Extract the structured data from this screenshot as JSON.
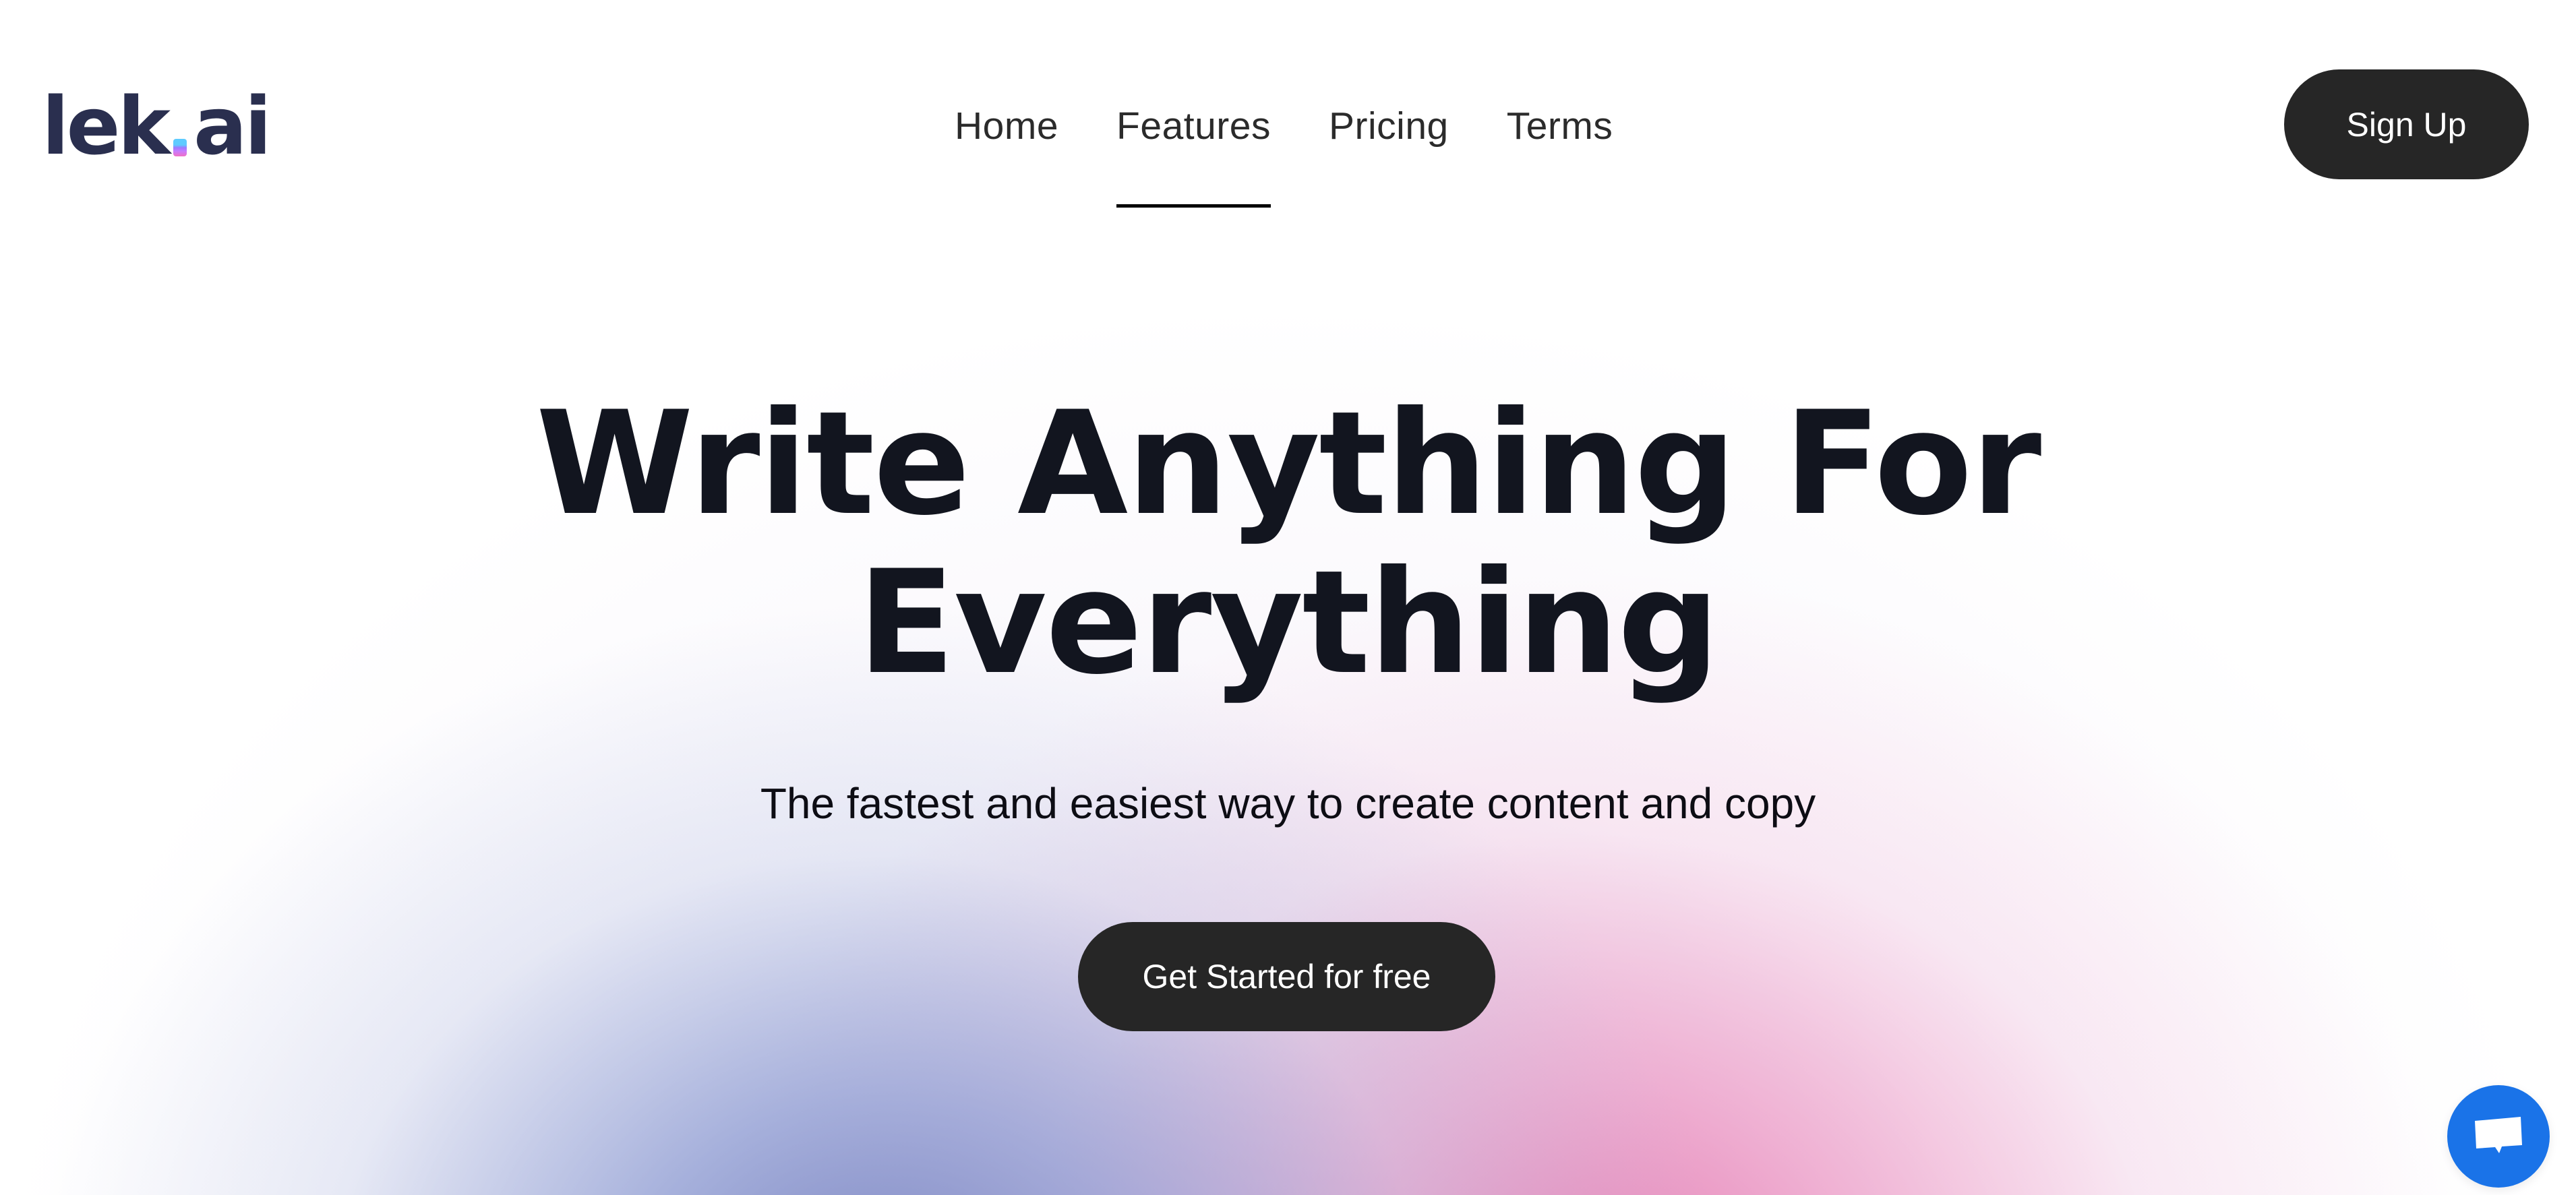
{
  "brand": {
    "logo_text_before": "lek",
    "logo_text_after": "ai",
    "logo_color": "#2a2f4f",
    "logo_dot_colors": [
      "#5ecbff",
      "#9b7bff",
      "#f06fc6"
    ]
  },
  "nav": {
    "items": [
      {
        "label": "Home",
        "active": false
      },
      {
        "label": "Features",
        "active": true
      },
      {
        "label": "Pricing",
        "active": false
      },
      {
        "label": "Terms",
        "active": false
      }
    ]
  },
  "header": {
    "signup_label": "Sign Up"
  },
  "hero": {
    "title_line1": "Write Anything For",
    "title_line2": "Everything",
    "subtitle": "The fastest and easiest way to create content and copy",
    "cta_label": "Get Started for free"
  },
  "chat_widget": {
    "icon": "chat-bubble-icon",
    "color": "#1a73e8"
  },
  "colors": {
    "button_bg": "#262626",
    "heading": "#12151f",
    "gradient_blue": "#7d88c4",
    "gradient_pink": "#e580b4"
  }
}
